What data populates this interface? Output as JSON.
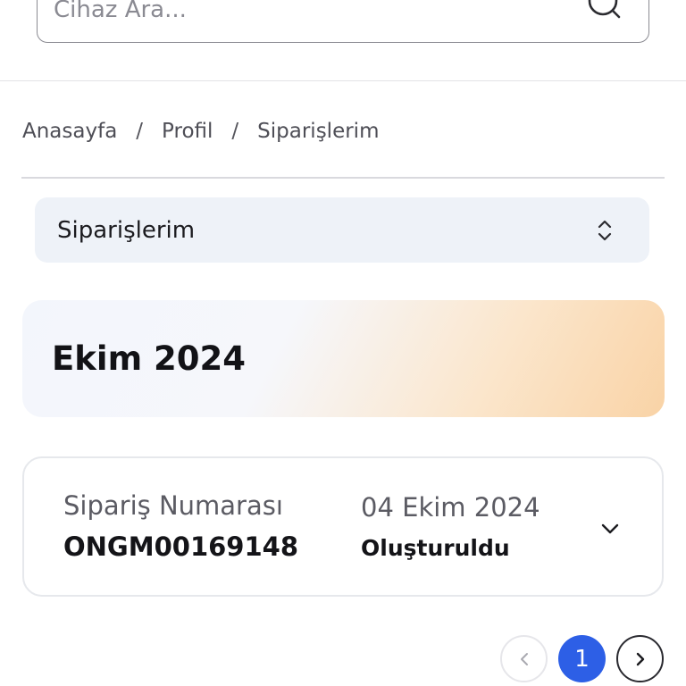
{
  "search": {
    "placeholder": "Cihaz Ara..."
  },
  "breadcrumb": {
    "items": [
      "Anasayfa",
      "Profil",
      "Siparişlerim"
    ],
    "separator": "/"
  },
  "filter": {
    "selected": "Siparişlerim"
  },
  "month_group": {
    "title": "Ekim 2024"
  },
  "order": {
    "number_label": "Sipariş Numarası",
    "number": "ONGM00169148",
    "date": "04 Ekim 2024",
    "status": "Oluşturuldu"
  },
  "pagination": {
    "current_page": "1"
  },
  "colors": {
    "accent": "#2d5fe6",
    "select_bg": "#eef2f8",
    "banner_warm": "#f9d3a6"
  },
  "icons": {
    "search": "search-icon",
    "select": "unfold-icon",
    "expand": "chevron-down-icon",
    "prev": "chevron-left-icon",
    "next": "chevron-right-icon"
  }
}
